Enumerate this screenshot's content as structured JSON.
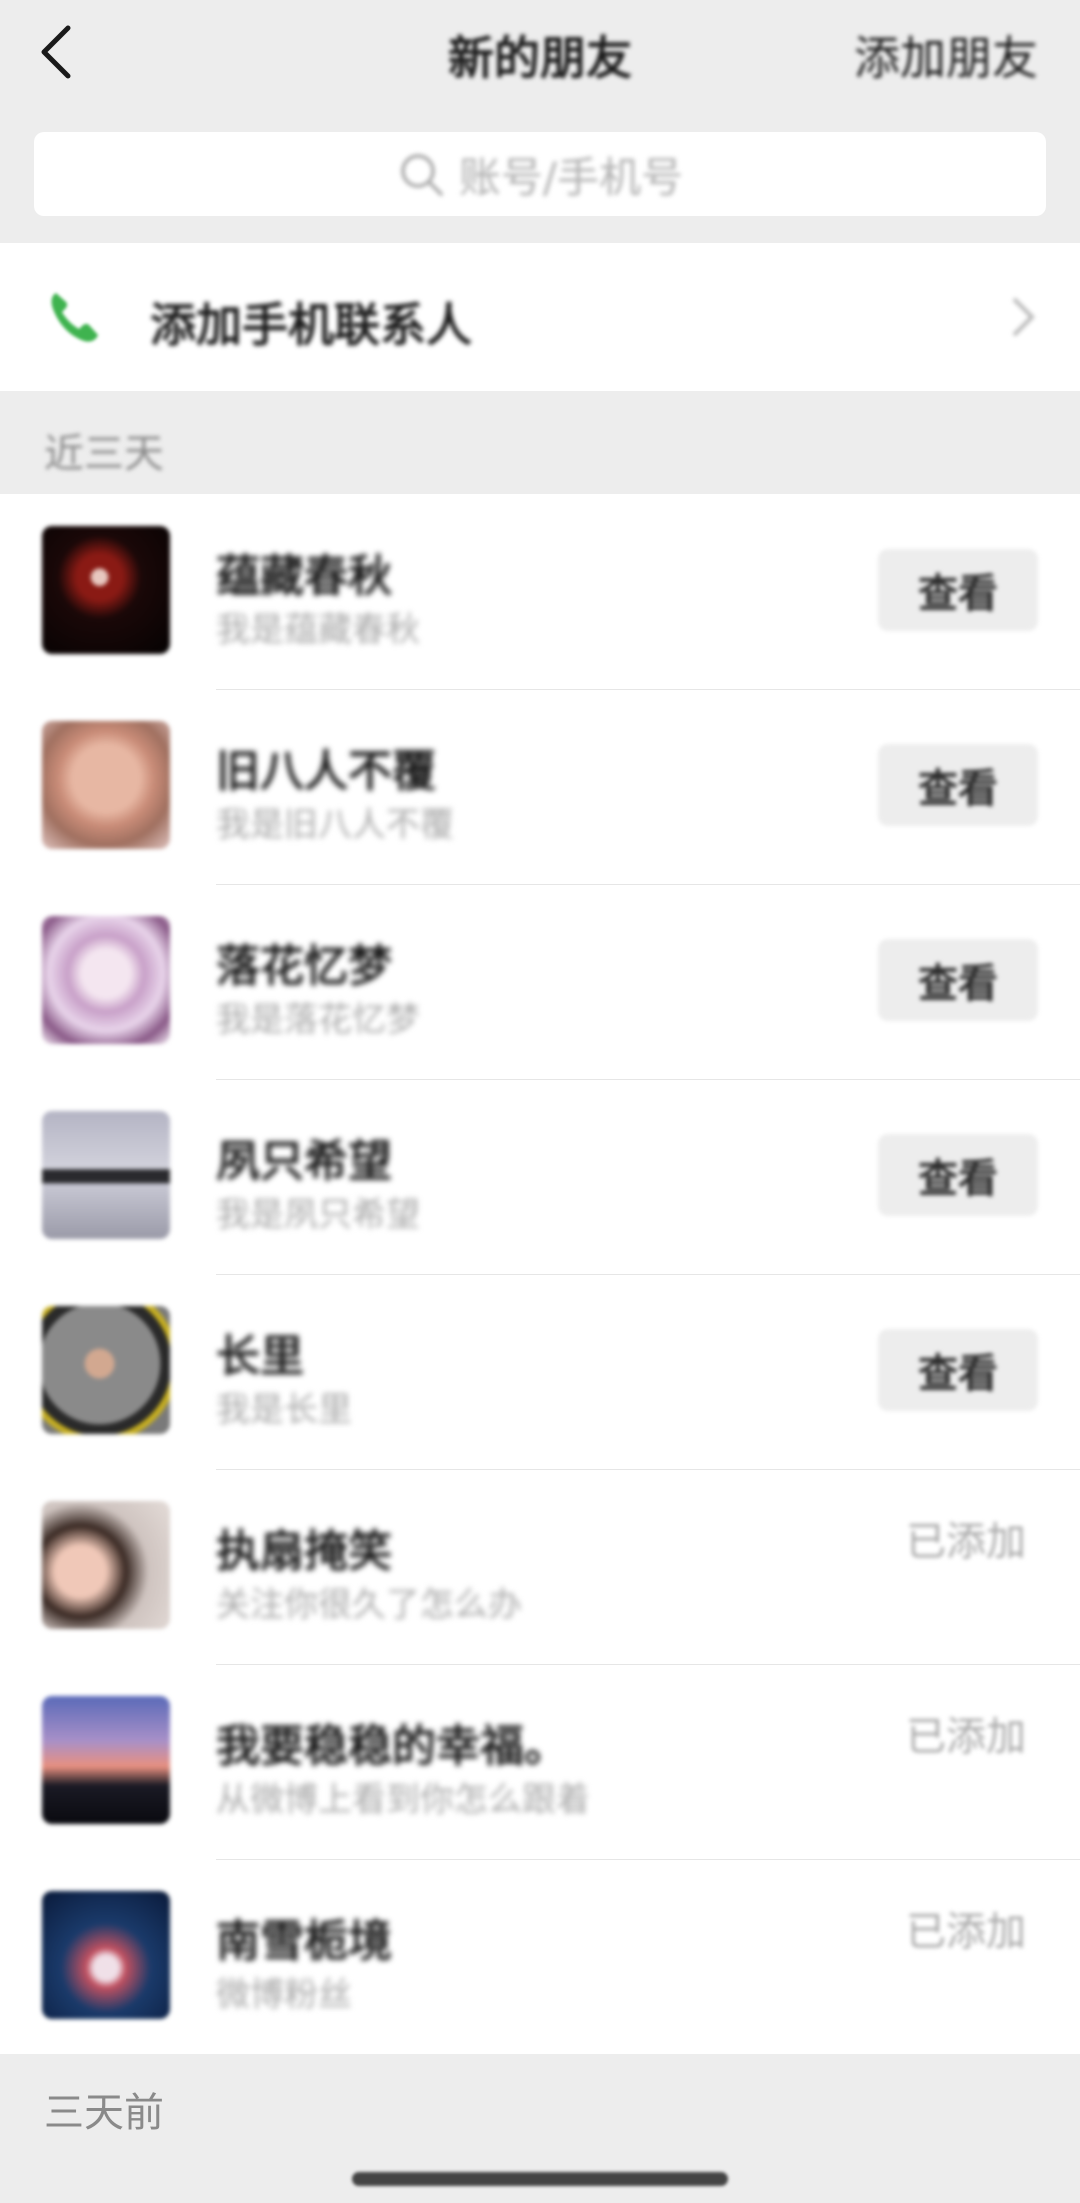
{
  "header": {
    "title": "新的朋友",
    "action": "添加朋友"
  },
  "search": {
    "placeholder": "账号/手机号"
  },
  "phone_contacts": {
    "label": "添加手机联系人"
  },
  "sections": [
    {
      "label": "近三天"
    },
    {
      "label": "三天前"
    }
  ],
  "requests": [
    {
      "name": "蕴藏春秋",
      "message": "我是蕴藏春秋",
      "action": "查看"
    },
    {
      "name": "旧八人不覆",
      "message": "我是旧八人不覆",
      "action": "查看"
    },
    {
      "name": "落花忆梦",
      "message": "我是落花忆梦",
      "action": "查看"
    },
    {
      "name": "夙只希望",
      "message": "我是夙只希望",
      "action": "查看"
    },
    {
      "name": "长里",
      "message": "我是长里",
      "action": "查看"
    },
    {
      "name": "执扇掩笑",
      "message": "关注你很久了怎么办",
      "action": "已添加"
    },
    {
      "name": "我要稳稳的幸福。",
      "message": "从微博上看到你怎么跟着",
      "action": "已添加"
    },
    {
      "name": "南雪栀境",
      "message": "微博粉丝",
      "action": "已添加"
    }
  ],
  "colors": {
    "background": "#ededed",
    "accent_green": "#3fb34f"
  },
  "icons": [
    "back-icon",
    "search-icon",
    "phone-icon",
    "chevron-right-icon"
  ]
}
